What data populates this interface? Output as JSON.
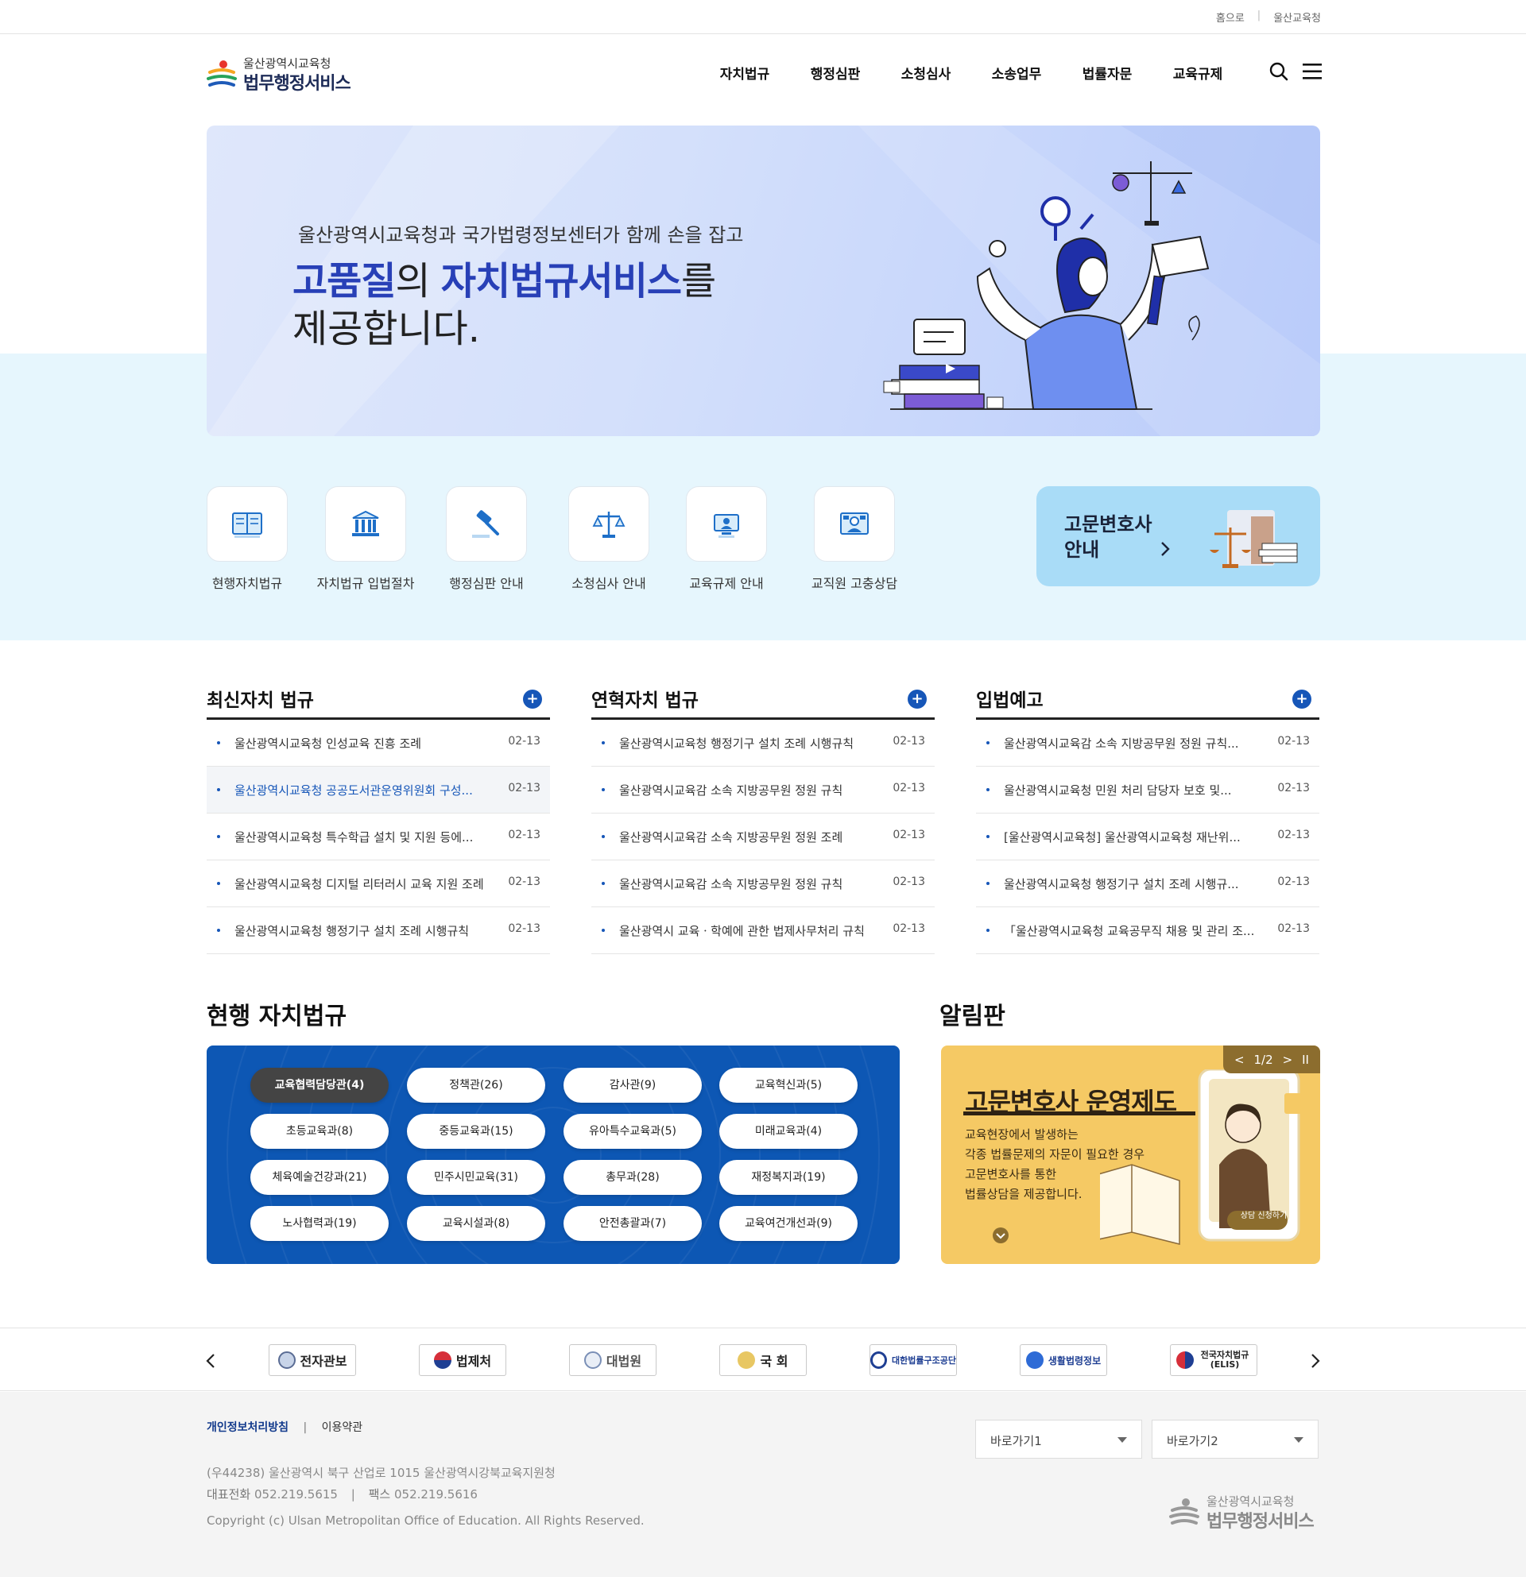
{
  "topbar": {
    "home": "홈으로",
    "office": "울산교육청"
  },
  "logo": {
    "line1": "울산광역시교육청",
    "line2": "법무행정서비스"
  },
  "nav": [
    "자치법규",
    "행정심판",
    "소청심사",
    "소송업무",
    "법률자문",
    "교육규제"
  ],
  "hero": {
    "subtitle": "울산광역시교육청과 국가법령정보센터가 함께 손을 잡고",
    "title_part1": "고품질",
    "title_part2": "의 ",
    "title_part3": "자치법규서비스",
    "title_part4": "를",
    "title_line2": "제공합니다."
  },
  "quick_menu": [
    {
      "label": "현행자치법규",
      "icon": "book-icon"
    },
    {
      "label": "자치법규 입법절차",
      "icon": "building-icon"
    },
    {
      "label": "행정심판 안내",
      "icon": "gavel-icon"
    },
    {
      "label": "소청심사 안내",
      "icon": "scale-icon"
    },
    {
      "label": "교육규제 안내",
      "icon": "monitor-icon"
    },
    {
      "label": "교직원 고충상담",
      "icon": "counsel-icon"
    }
  ],
  "lawyer_card": {
    "line1": "고문변호사",
    "line2": "안내"
  },
  "boards": [
    {
      "title": "최신자치 법규",
      "items": [
        {
          "title": "울산광역시교육청 인성교육 진흥 조례",
          "date": "02-13"
        },
        {
          "title": "울산광역시교육청 공공도서관운영위원회 구성...",
          "date": "02-13"
        },
        {
          "title": "울산광역시교육청 특수학급 설치 및 지원 등에...",
          "date": "02-13"
        },
        {
          "title": "울산광역시교육청 디지털 리터러시 교육 지원 조례",
          "date": "02-13"
        },
        {
          "title": "울산광역시교육청 행정기구 설치 조례 시행규칙",
          "date": "02-13"
        }
      ]
    },
    {
      "title": "연혁자치 법규",
      "items": [
        {
          "title": "울산광역시교육청 행정기구 설치 조례 시행규칙",
          "date": "02-13"
        },
        {
          "title": "울산광역시교육감 소속 지방공무원 정원 규칙",
          "date": "02-13"
        },
        {
          "title": "울산광역시교육감 소속 지방공무원 정원 조례",
          "date": "02-13"
        },
        {
          "title": "울산광역시교육감 소속 지방공무원 정원 규칙",
          "date": "02-13"
        },
        {
          "title": "울산광역시 교육ㆍ학예에 관한 법제사무처리 규칙",
          "date": "02-13"
        }
      ]
    },
    {
      "title": "입법예고",
      "items": [
        {
          "title": "울산광역시교육감 소속 지방공무원 정원 규칙...",
          "date": "02-13"
        },
        {
          "title": "울산광역시교육청 민원 처리 담당자 보호 및...",
          "date": "02-13"
        },
        {
          "title": "[울산광역시교육청] 울산광역시교육청 재난위...",
          "date": "02-13"
        },
        {
          "title": "울산광역시교육청 행정기구 설치 조례 시행규...",
          "date": "02-13"
        },
        {
          "title": "「울산광역시교육청 교육공무직 채용 및 관리 조...",
          "date": "02-13"
        }
      ]
    }
  ],
  "current_regs": {
    "title": "현행 자치법규",
    "departments": [
      "교육협력담당관(4)",
      "정책관(26)",
      "감사관(9)",
      "교육혁신과(5)",
      "초등교육과(8)",
      "중등교육과(15)",
      "유아특수교육과(5)",
      "미래교육과(4)",
      "체육예술건강과(21)",
      "민주시민교육(31)",
      "총무과(28)",
      "재정복지과(19)",
      "노사협력과(19)",
      "교육시설과(8)",
      "안전총괄과(7)",
      "교육여건개선과(9)"
    ]
  },
  "notice": {
    "title": "알림판",
    "pager": "1/2",
    "banner_title": "고문변호사 운영제도",
    "banner_lines": [
      "교육현장에서 발생하는",
      "각종 법률문제의 자문이 필요한 경우",
      "고문변호사를 통한",
      "법률상담을 제공합니다."
    ],
    "banner_button": "상담 신청하기"
  },
  "related_links": [
    "전자관보",
    "법제처",
    "대법원",
    "국 회",
    "대한법률구조공단",
    "생활법령정보",
    "전국자치법규(ELIS)"
  ],
  "footer": {
    "privacy": "개인정보처리방침",
    "terms": "이용약관",
    "address": "(우44238) 울산광역시 북구 산업로 1015 울산광역시강북교육지원청",
    "phone_label": "대표전화",
    "phone": "052.219.5615",
    "fax_label": "팩스",
    "fax": "052.219.5616",
    "copyright": "Copyright (c) Ulsan Metropolitan Office of Education. All Rights Reserved.",
    "select1": "바로가기1",
    "select2": "바로가기2"
  },
  "colors": {
    "accent": "#1656b8",
    "hero_blue": "#2840b7",
    "dept_bg": "#0d57b4",
    "notice_bg": "#f5c964",
    "light_bg": "#e6f6fd"
  }
}
